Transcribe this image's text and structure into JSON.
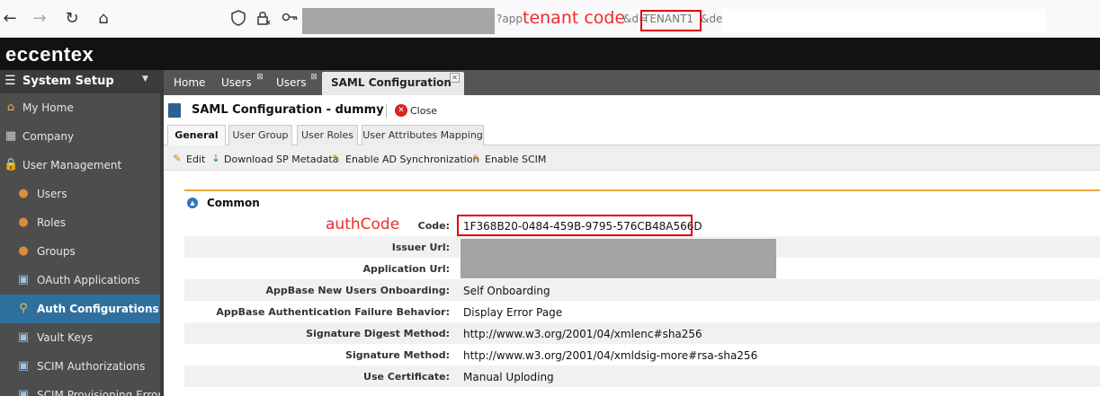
{
  "browser": {
    "url_fragment_1": "?app",
    "url_fragment_2": "&d=",
    "tenant_value": "TENANT1",
    "url_fragment_3": "&de"
  },
  "annotations": {
    "tenant_code": "tenant code",
    "auth_code": "authCode",
    "color": "#ee2b2b"
  },
  "app": {
    "logo": "eccentex"
  },
  "sidebar": {
    "title": "System Setup",
    "items": [
      {
        "label": "My Home",
        "icon": "home-icon",
        "indent": false,
        "active": false
      },
      {
        "label": "Company",
        "icon": "building-icon",
        "indent": false,
        "active": false
      },
      {
        "label": "User Management",
        "icon": "lock-icon",
        "indent": false,
        "active": false
      },
      {
        "label": "Users",
        "icon": "user-icon",
        "indent": true,
        "active": false
      },
      {
        "label": "Roles",
        "icon": "roles-icon",
        "indent": true,
        "active": false
      },
      {
        "label": "Groups",
        "icon": "group-icon",
        "indent": true,
        "active": false
      },
      {
        "label": "OAuth Applications",
        "icon": "application-icon",
        "indent": true,
        "active": false
      },
      {
        "label": "Auth Configurations",
        "icon": "key-icon",
        "indent": true,
        "active": true
      },
      {
        "label": "Vault Keys",
        "icon": "vault-icon",
        "indent": true,
        "active": false
      },
      {
        "label": "SCIM Authorizations",
        "icon": "scim-icon",
        "indent": true,
        "active": false
      },
      {
        "label": "SCIM Provisioning Errors",
        "icon": "error-icon",
        "indent": true,
        "active": false
      }
    ]
  },
  "tabs": {
    "home": "Home",
    "users_1": "Users",
    "users_2": "Users",
    "saml": "SAML Configuration"
  },
  "panel": {
    "title": "SAML Configuration - dummy",
    "close": "Close"
  },
  "subtabs": [
    "General",
    "User Group",
    "User Roles",
    "User Attributes Mapping"
  ],
  "toolbar": {
    "edit": "Edit",
    "download": "Download SP Metadata",
    "enable_ad": "Enable AD Synchronization",
    "enable_scim": "Enable SCIM"
  },
  "section": {
    "title": "Common"
  },
  "fields": [
    {
      "label": "Code:",
      "value": "1F368B20-0484-459B-9795-576CB48A566D"
    },
    {
      "label": "Issuer Url:",
      "value": ""
    },
    {
      "label": "Application Url:",
      "value": ""
    },
    {
      "label": "AppBase New Users Onboarding:",
      "value": "Self Onboarding"
    },
    {
      "label": "AppBase Authentication Failure Behavior:",
      "value": "Display Error Page"
    },
    {
      "label": "Signature Digest Method:",
      "value": "http://www.w3.org/2001/04/xmlenc#sha256"
    },
    {
      "label": "Signature Method:",
      "value": "http://www.w3.org/2001/04/xmldsig-more#rsa-sha256"
    },
    {
      "label": "Use Certificate:",
      "value": "Manual Uploding"
    }
  ]
}
